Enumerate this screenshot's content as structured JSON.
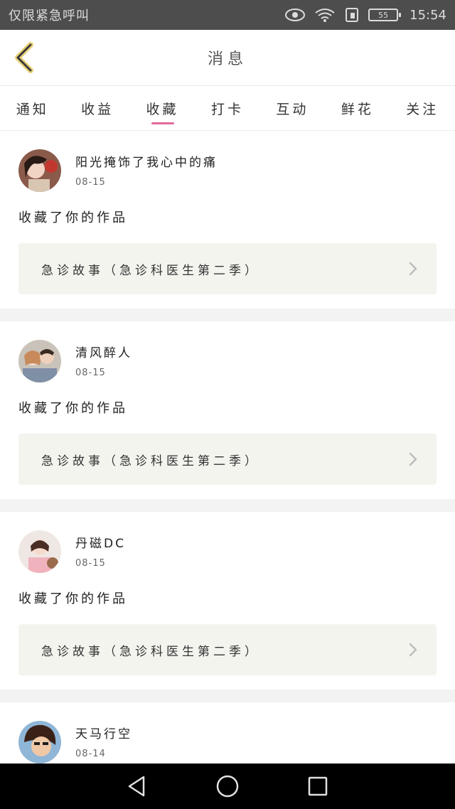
{
  "status_bar": {
    "carrier": "仅限紧急呼叫",
    "battery": "55",
    "time": "15:54"
  },
  "header": {
    "title": "消息"
  },
  "tabs": [
    {
      "label": "通知",
      "active": false
    },
    {
      "label": "收益",
      "active": false
    },
    {
      "label": "收藏",
      "active": true
    },
    {
      "label": "打卡",
      "active": false
    },
    {
      "label": "互动",
      "active": false
    },
    {
      "label": "鲜花",
      "active": false
    },
    {
      "label": "关注",
      "active": false
    }
  ],
  "accent_color": "#e36a9b",
  "items": [
    {
      "name": "阳光掩饰了我心中的痛",
      "date": "08-15",
      "action": "收藏了你的作品",
      "work": "急诊故事（急诊科医生第二季）"
    },
    {
      "name": "清风醉人",
      "date": "08-15",
      "action": "收藏了你的作品",
      "work": "急诊故事（急诊科医生第二季）"
    },
    {
      "name": "丹磁DC",
      "date": "08-15",
      "action": "收藏了你的作品",
      "work": "急诊故事（急诊科医生第二季）"
    },
    {
      "name": "天马行空",
      "date": "08-14"
    }
  ]
}
